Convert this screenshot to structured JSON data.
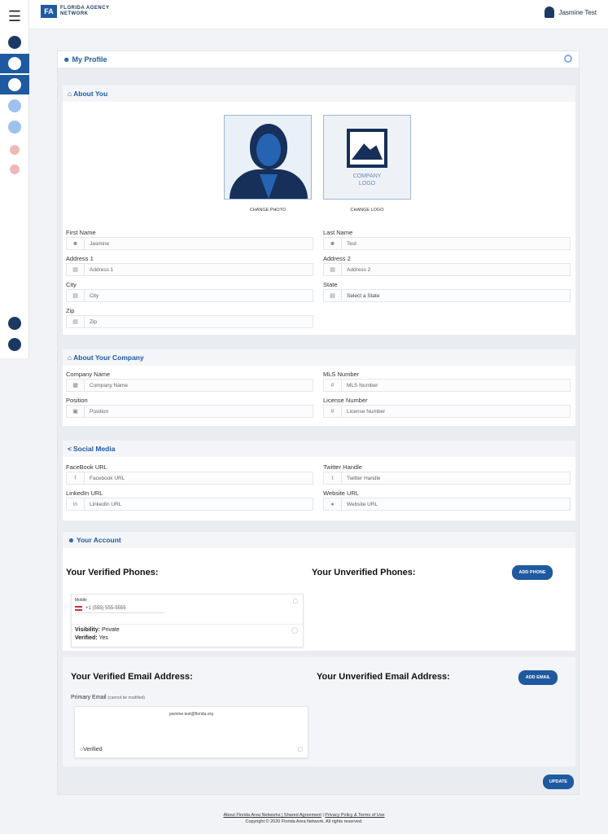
{
  "topbar": {
    "logo_mark": "FA",
    "logo_text_1": "FLORIDA AGENCY",
    "logo_text_2": "NETWORK",
    "user_name": "Jasmine Test"
  },
  "panel": {
    "title": "My Profile"
  },
  "about_you": {
    "title": "About You",
    "photo_caption": "CHANGE PHOTO",
    "logo_caption": "CHANGE LOGO",
    "logo_placeholder_1": "COMPANY",
    "logo_placeholder_2": "LOGO",
    "fields": {
      "first_name": {
        "label": "First Name",
        "value": "Jasmine"
      },
      "last_name": {
        "label": "Last Name",
        "value": "Test"
      },
      "address1": {
        "label": "Address 1",
        "placeholder": "Address 1"
      },
      "address2": {
        "label": "Address 2",
        "placeholder": "Address 2"
      },
      "city": {
        "label": "City",
        "placeholder": "City"
      },
      "state": {
        "label": "State",
        "value": "Select a State"
      },
      "zip": {
        "label": "Zip",
        "placeholder": "Zip"
      }
    }
  },
  "about_company": {
    "title": "About Your Company",
    "fields": {
      "company_name": {
        "label": "Company Name",
        "placeholder": "Company Name"
      },
      "mls_number": {
        "label": "MLS Number",
        "placeholder": "MLS Number"
      },
      "position": {
        "label": "Position",
        "placeholder": "Position"
      },
      "license_number": {
        "label": "License Number",
        "placeholder": "License Number"
      }
    }
  },
  "social": {
    "title": "Social Media",
    "fields": {
      "facebook": {
        "label": "FaceBook URL",
        "placeholder": "Facebook URL"
      },
      "twitter": {
        "label": "Twitter Handle",
        "placeholder": "Twitter Handle"
      },
      "linkedin": {
        "label": "LinkedIn URL",
        "placeholder": "LinkedIn URL"
      },
      "website": {
        "label": "Website URL",
        "placeholder": "Website URL"
      }
    }
  },
  "account": {
    "title": "Your Account",
    "verified_phones": "Your Verified Phones:",
    "unverified_phones": "Your Unverified Phones:",
    "add_phone": "ADD PHONE",
    "phone_card": {
      "type": "Mobile",
      "number": "+1 (555) 555-5555",
      "visibility_label": "Visibility:",
      "visibility_value": "Private",
      "verified_label": "Verified:",
      "verified_value": "Yes"
    },
    "verified_email": "Your Verified Email Address:",
    "unverified_email": "Your Unverified Email Address:",
    "add_email": "ADD EMAIL",
    "primary_email_label": "Primary Email",
    "primary_email_hint": "(cannot be modified)",
    "email_value": "jasmine.test@florida.org",
    "email_verified": "Verified"
  },
  "update_button": "UPDATE",
  "footer": {
    "link1": "About Florida Area Networks | Shared Agreement",
    "link2": "Privacy Policy & Terms of Use",
    "copyright": "Copyright © 2020 Florida Area Network. All rights reserved."
  }
}
